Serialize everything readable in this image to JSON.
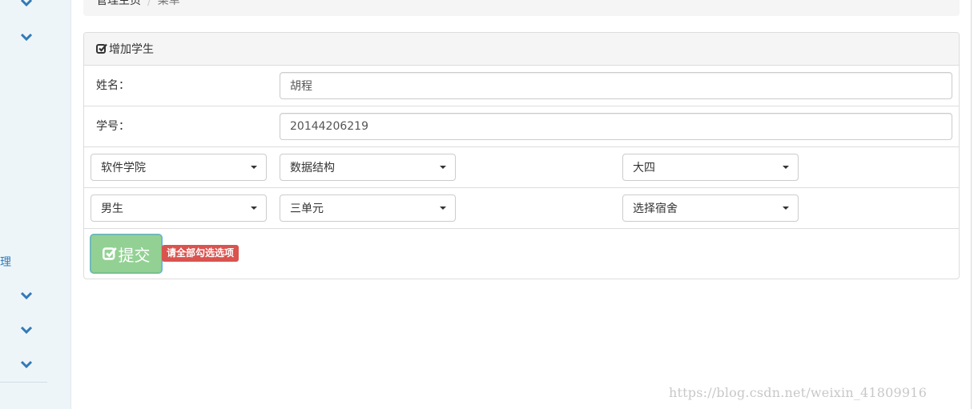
{
  "breadcrumb": {
    "items": [
      "管理主页",
      "菜单"
    ],
    "separator": "/"
  },
  "sidebar": {
    "partial_text": "理",
    "chevron_icon": "chevron-down-icon",
    "accent_color": "#337ab7"
  },
  "panel": {
    "title": "增加学生",
    "title_icon": "check-square-icon"
  },
  "form": {
    "name_label": "姓名：",
    "name_value": "胡程",
    "id_label": "学号：",
    "id_value": "20144206219",
    "college_select": "软件学院",
    "course_select": "数据结构",
    "grade_select": "大四",
    "gender_select": "男生",
    "unit_select": "三单元",
    "dorm_select": "选择宿舍"
  },
  "submit": {
    "label": "提交",
    "icon": "check-square-icon",
    "color": "#92d193"
  },
  "warning": {
    "text": "请全部勾选选项",
    "color": "#d9534f"
  },
  "watermark": "https://blog.csdn.net/weixin_41809916"
}
